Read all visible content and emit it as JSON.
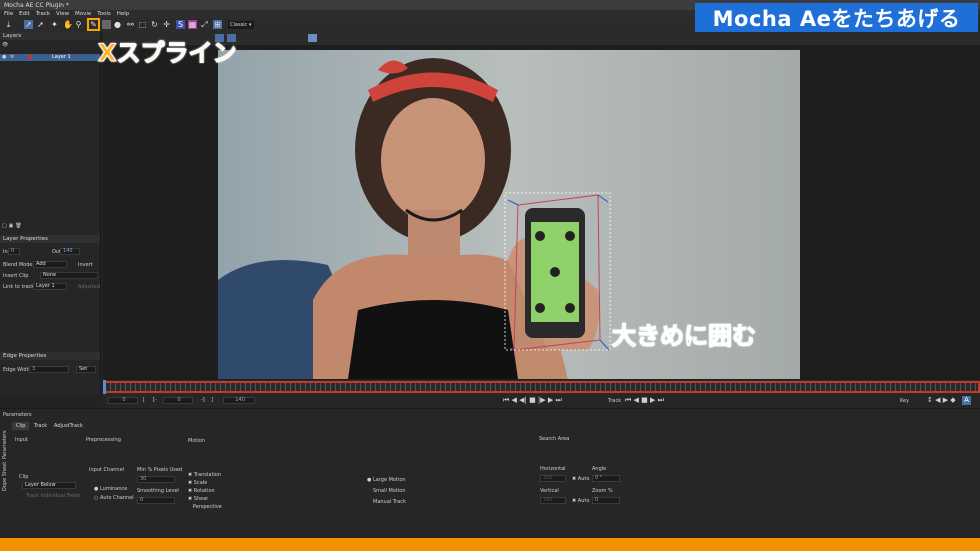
{
  "window": {
    "title": "Mocha AE CC Plugin *"
  },
  "menu": [
    "File",
    "Edit",
    "Track",
    "View",
    "Movie",
    "Tools",
    "Help"
  ],
  "toolbar": {
    "view_mode": "Classic"
  },
  "layers_panel": {
    "title": "Layers",
    "layer_name": "Layer 1"
  },
  "layer_properties": {
    "title": "Layer Properties",
    "in_label": "In",
    "in_value": "0",
    "out_label": "Out",
    "out_value": "140",
    "blend_mode_label": "Blend Mode",
    "blend_mode_value": "Add",
    "invert_label": "Invert",
    "insert_clip_label": "Insert Clip",
    "insert_clip_value": "None",
    "link_to_track_label": "Link to track",
    "link_to_track_value": "Layer 1",
    "adjusted_label": "Adjusted"
  },
  "edge_properties": {
    "title": "Edge Properties",
    "edge_width_label": "Edge Width",
    "edge_width_value": "3",
    "set_label": "Set"
  },
  "timeline": {
    "current_frame": "0",
    "start_frame": "0",
    "end_frame": "140",
    "track_label": "Track",
    "key_label": "Key"
  },
  "parameters": {
    "title": "Parameters",
    "tabs": [
      "Clip",
      "Track",
      "AdjustTrack"
    ],
    "side_tabs": [
      "Parameters",
      "Dope Sheet"
    ],
    "input": {
      "title": "Input",
      "clip_label": "Clip",
      "clip_value": "Layer Below",
      "track_individual_fields": "Track Individual Fields"
    },
    "preprocessing": {
      "title": "Preprocessing",
      "input_channel_label": "Input Channel",
      "luminance": "Luminance",
      "auto_channel": "Auto Channel",
      "min_pixels_label": "Min % Pixels Used",
      "min_pixels_value": "30",
      "smoothing_label": "Smoothing Level",
      "smoothing_value": "0"
    },
    "motion": {
      "title": "Motion",
      "options": [
        "Translation",
        "Scale",
        "Rotation",
        "Shear",
        "Perspective"
      ],
      "modes": [
        "Large Motion",
        "Small Motion",
        "Manual Track"
      ]
    },
    "search_area": {
      "title": "Search Area",
      "horizontal_label": "Horizontal",
      "horizontal_value": "320",
      "auto_label": "Auto",
      "angle_label": "Angle",
      "angle_value": "0 °",
      "vertical_label": "Vertical",
      "vertical_value": "180",
      "zoom_label": "Zoom %",
      "zoom_value": "0"
    }
  },
  "overlays": {
    "title_badge": "Mocha Aeをたちあげる",
    "tool_label": "Xスプライン",
    "tip_label": "大きめに囲む"
  },
  "colors": {
    "title_badge_bg": "#1f6fd8",
    "overlay_text": "#ffb01a",
    "bottom_bar": "#f39200",
    "timeline_marker": "#c0392b"
  }
}
